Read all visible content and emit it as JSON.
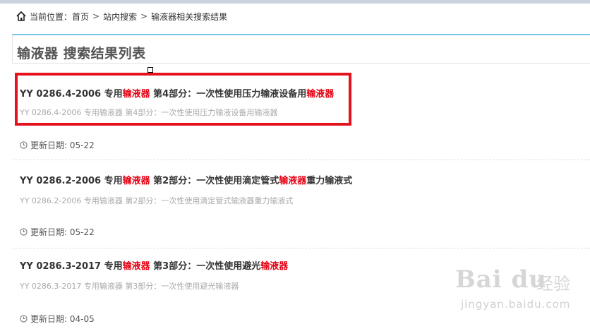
{
  "breadcrumb": {
    "prefix": "当前位置：",
    "items": [
      "首页",
      "站内搜索",
      "输液器相关搜索结果"
    ],
    "separator": ">"
  },
  "page_title": "输液器 搜索结果列表",
  "results": [
    {
      "title_parts": [
        {
          "text": "YY 0286.4-",
          "hl": false
        },
        {
          "text": "2006 专用",
          "hl": false
        },
        {
          "text": "输液器",
          "hl": true
        },
        {
          "text": " 第4部分：一次性使用压力输液设备用",
          "hl": false
        },
        {
          "text": "输液器",
          "hl": true
        }
      ],
      "subtitle": "YY 0286.4-2006 专用输液器 第4部分：一次性使用压力输液设备用输液器",
      "date_label": "更新日期:",
      "date": "05-22"
    },
    {
      "title_parts": [
        {
          "text": "YY 0286.2-2006 专用",
          "hl": false
        },
        {
          "text": "输液器",
          "hl": true
        },
        {
          "text": " 第2部分：一次性使用滴定管式",
          "hl": false
        },
        {
          "text": "输液器",
          "hl": true
        },
        {
          "text": "重力输液式",
          "hl": false
        }
      ],
      "subtitle": "YY 0286.2-2006 专用输液器 第2部分：一次性使用滴定管式输液器重力输液式",
      "date_label": "更新日期:",
      "date": "05-22"
    },
    {
      "title_parts": [
        {
          "text": "YY 0286.3-2017 专用",
          "hl": false
        },
        {
          "text": "输液器",
          "hl": true
        },
        {
          "text": " 第3部分：一次性使用避光",
          "hl": false
        },
        {
          "text": "输液器",
          "hl": true
        }
      ],
      "subtitle": "YY 0286.3-2017 专用输液器 第3部分：一次性使用避光输液器",
      "date_label": "更新日期:",
      "date": "04-05"
    }
  ],
  "watermark": {
    "logo": "Bai du",
    "cn": "经验",
    "url": "jingyan.baidu.com"
  },
  "colors": {
    "highlight": "#e60012",
    "title_border": "#7cc6e4",
    "annotation_box": "#e3121c"
  }
}
